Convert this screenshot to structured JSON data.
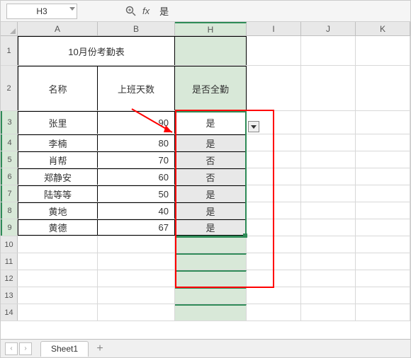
{
  "namebox": "H3",
  "fx_label": "fx",
  "formula_value": "是",
  "columns": {
    "A": "A",
    "B": "B",
    "H": "H",
    "I": "I",
    "J": "J",
    "K": "K"
  },
  "row_nums": [
    "1",
    "2",
    "3",
    "4",
    "5",
    "6",
    "7",
    "8",
    "9",
    "10",
    "11",
    "12",
    "13",
    "14"
  ],
  "title": "10月份考勤表",
  "headers": {
    "name": "名称",
    "days": "上班天数",
    "full": "是否全勤"
  },
  "rows": [
    {
      "name": "张里",
      "days": "90",
      "full": "是"
    },
    {
      "name": "李楠",
      "days": "80",
      "full": "是"
    },
    {
      "name": "肖帮",
      "days": "70",
      "full": "否"
    },
    {
      "name": "郑静安",
      "days": "60",
      "full": "否"
    },
    {
      "name": "陆等等",
      "days": "50",
      "full": "是"
    },
    {
      "name": "黄地",
      "days": "40",
      "full": "是"
    },
    {
      "name": "黄德",
      "days": "67",
      "full": "是"
    }
  ],
  "sheet_name": "Sheet1",
  "chart_data": {
    "type": "table",
    "title": "10月份考勤表",
    "columns": [
      "名称",
      "上班天数",
      "是否全勤"
    ],
    "rows": [
      [
        "张里",
        90,
        "是"
      ],
      [
        "李楠",
        80,
        "是"
      ],
      [
        "肖帮",
        70,
        "否"
      ],
      [
        "郑静安",
        60,
        "否"
      ],
      [
        "陆等等",
        50,
        "是"
      ],
      [
        "黄地",
        40,
        "是"
      ],
      [
        "黄德",
        67,
        "是"
      ]
    ]
  }
}
